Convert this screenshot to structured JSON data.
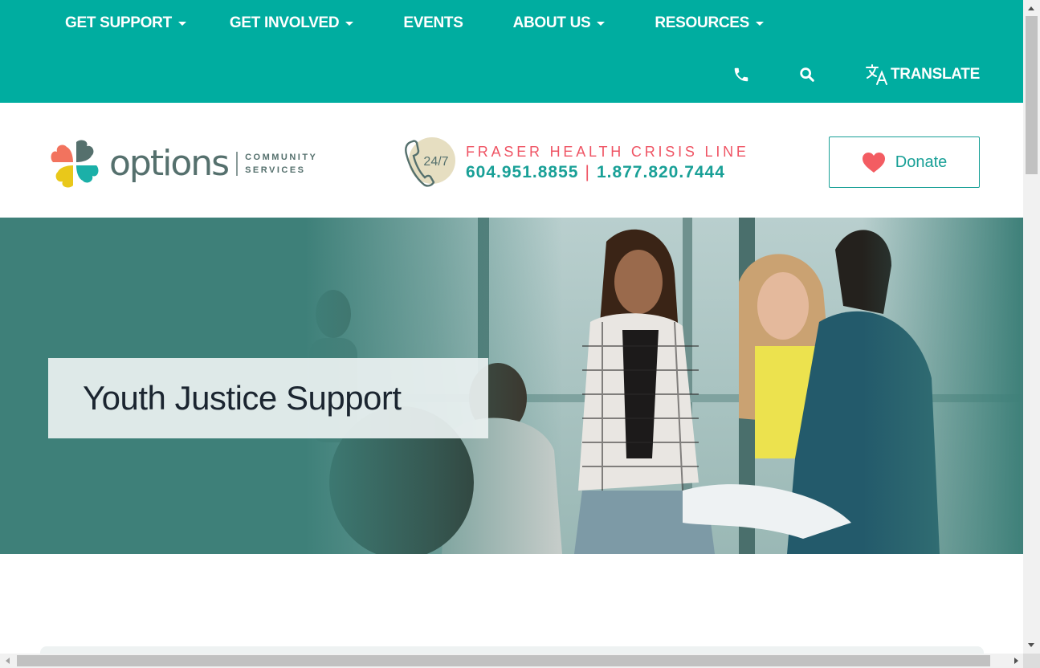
{
  "nav": {
    "items": [
      {
        "label": "GET SUPPORT",
        "dropdown": true
      },
      {
        "label": "GET INVOLVED",
        "dropdown": true
      },
      {
        "label": "EVENTS",
        "dropdown": false
      },
      {
        "label": "ABOUT US",
        "dropdown": true
      },
      {
        "label": "RESOURCES",
        "dropdown": true
      }
    ],
    "phone_icon": "phone-icon",
    "search_icon": "search-icon",
    "translate_label": "TRANSLATE",
    "translate_icon": "translate-icon"
  },
  "header": {
    "logo": {
      "wordmark": "options",
      "sub_line1": "COMMUNITY",
      "sub_line2": "SERVICES"
    },
    "crisis": {
      "badge": "24/7",
      "title": "FRASER HEALTH CRISIS LINE",
      "number1": "604.951.8855",
      "separator": "|",
      "number2": "1.877.820.7444"
    },
    "donate_label": "Donate"
  },
  "hero": {
    "title": "Youth Justice Support"
  },
  "colors": {
    "brand_teal": "#00ada0",
    "text_teal": "#19a097",
    "accent_coral": "#ef5464",
    "hero_teal": "#3e8079",
    "title_dark": "#1b2530"
  }
}
